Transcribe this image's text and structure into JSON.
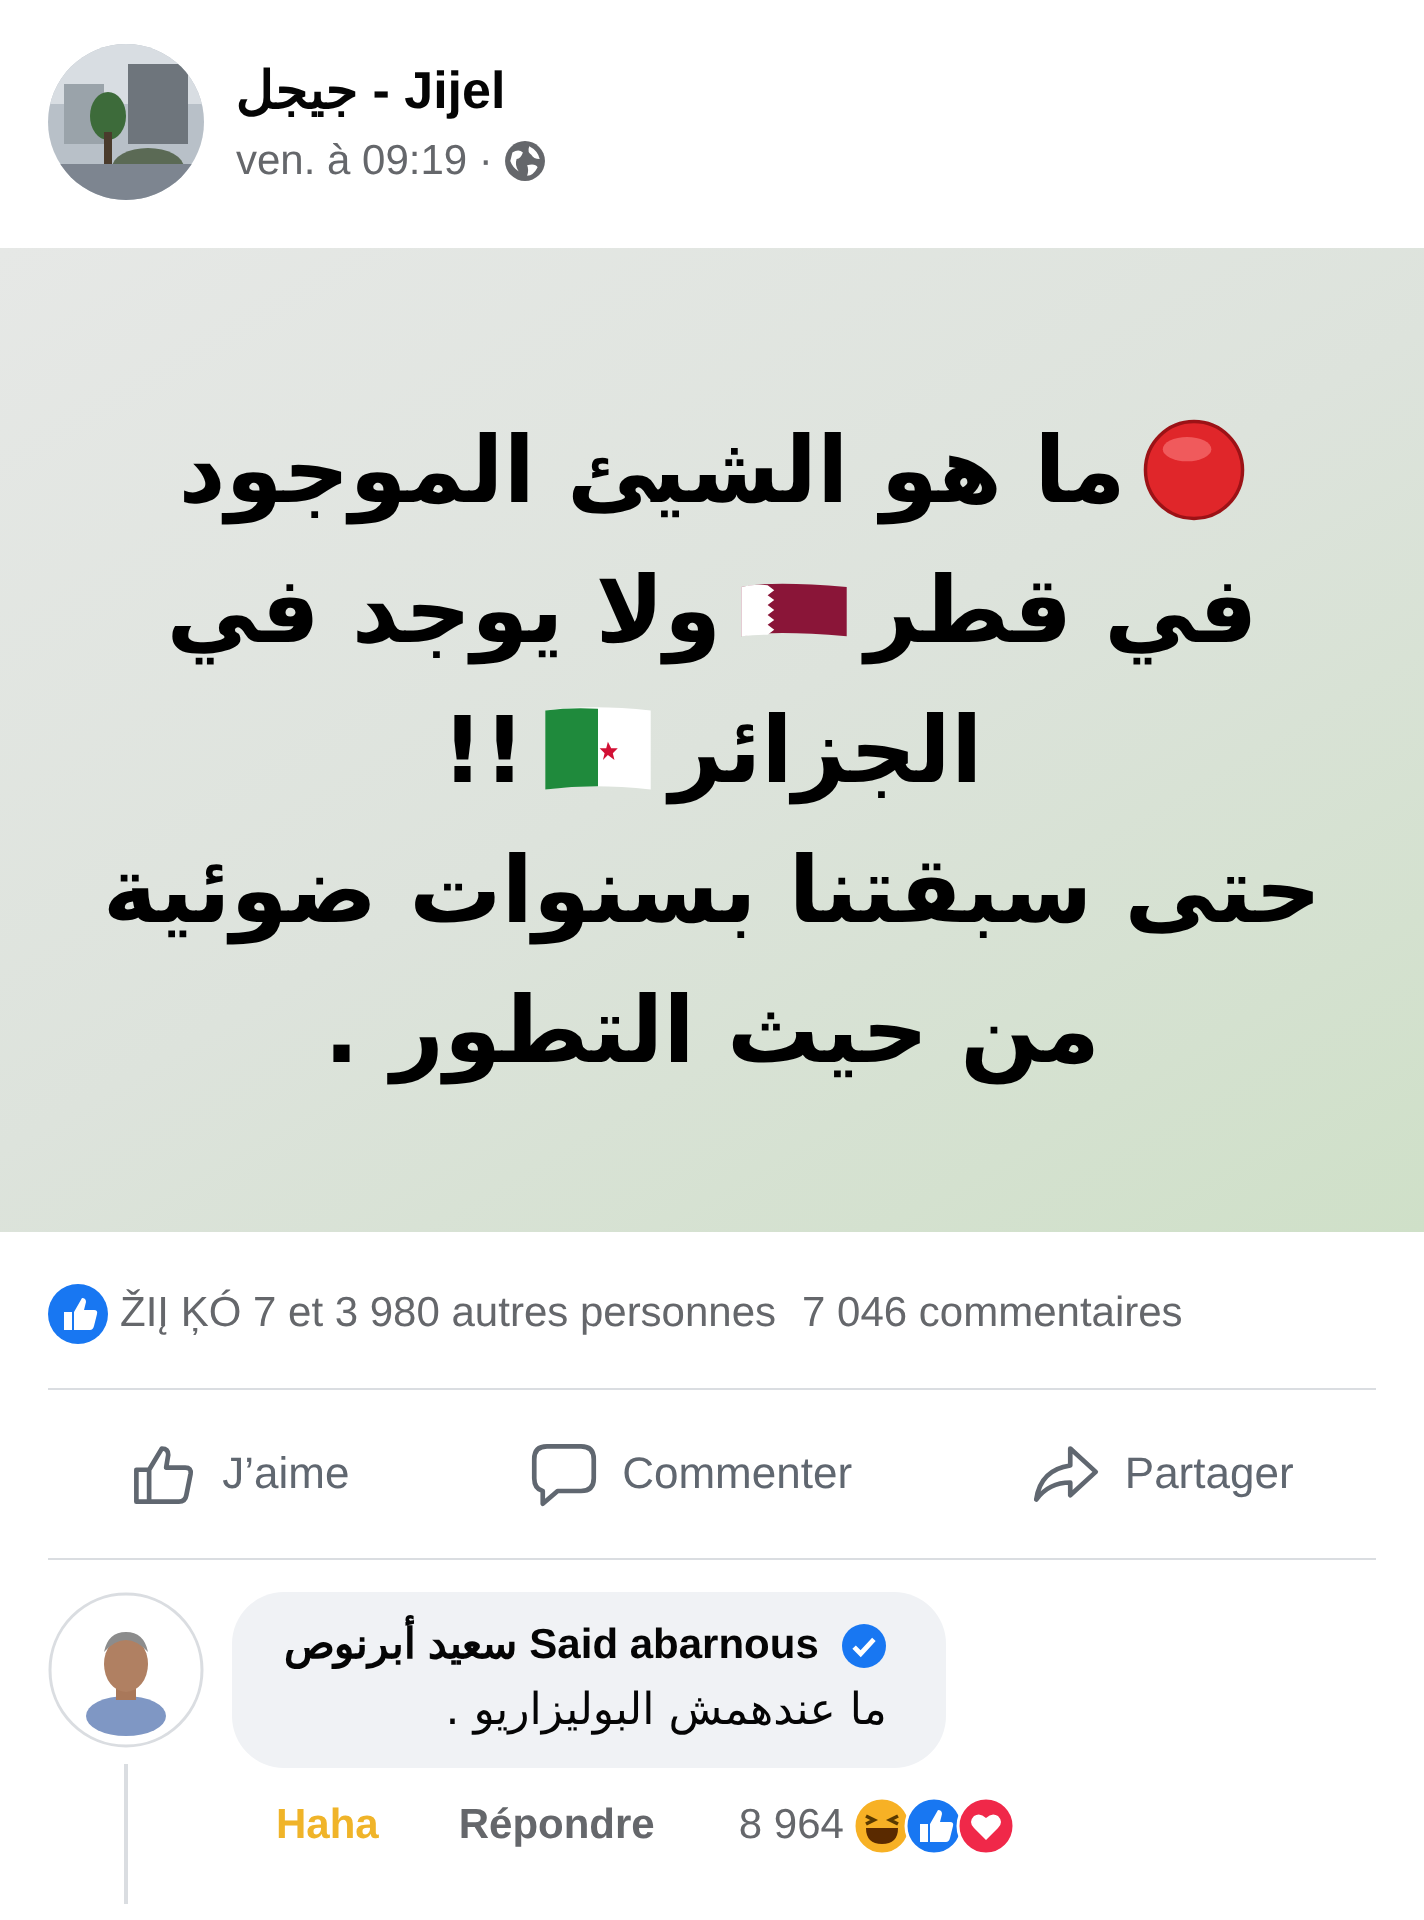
{
  "post": {
    "author": "جيجل - Jijel",
    "time": "ven. à 09:19 ·",
    "image": {
      "lines": [
        [
          {
            "kind": "mark"
          },
          {
            "kind": "text",
            "text": "ما هو الشيئ الموجود"
          }
        ],
        [
          {
            "kind": "text",
            "text": "في قطر"
          },
          {
            "kind": "mark"
          },
          {
            "kind": "text",
            "text": "ولا يوجد في"
          }
        ],
        [
          {
            "kind": "text",
            "text": "الجزائر"
          },
          {
            "kind": "mark"
          },
          {
            "kind": "text",
            "text": "!!"
          }
        ],
        [
          {
            "kind": "text",
            "text": "حتى سبقتنا بسنوات ضوئية"
          }
        ],
        [
          {
            "kind": "text",
            "text": "من حيث التطور ."
          }
        ]
      ]
    },
    "likes": "ŽIĮ ĶÓ 7 et 3 980 autres personnes",
    "comments_count": "7 046 commentaires",
    "like_button": "J’aime",
    "comment_button": "Commenter",
    "share_button": "Partager"
  },
  "comment": {
    "author": "Said abarnous سعيد أبرنوص",
    "verified": true,
    "text": "ما عندهمش البوليزاريو .",
    "reaction": {
      "label": "Haha",
      "active": true
    },
    "reply": "Répondre",
    "count": "8 964"
  }
}
